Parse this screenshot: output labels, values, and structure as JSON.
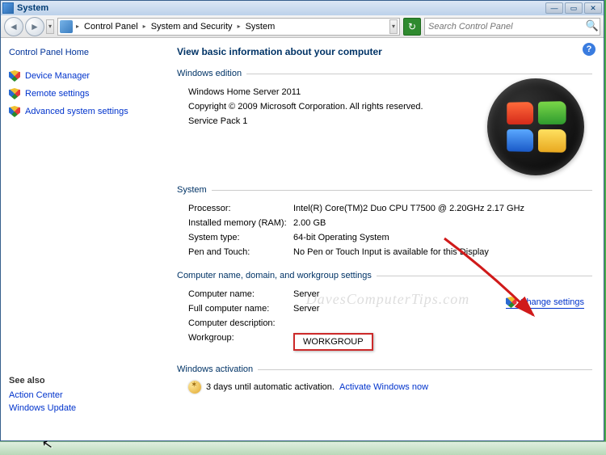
{
  "window": {
    "title": "System"
  },
  "breadcrumb": {
    "root": "Control Panel",
    "mid": "System and Security",
    "leaf": "System"
  },
  "search": {
    "placeholder": "Search Control Panel"
  },
  "sidebar": {
    "home": "Control Panel Home",
    "links": [
      {
        "label": "Device Manager"
      },
      {
        "label": "Remote settings"
      },
      {
        "label": "Advanced system settings"
      }
    ],
    "see_also_title": "See also",
    "see_also": [
      {
        "label": "Action Center"
      },
      {
        "label": "Windows Update"
      }
    ]
  },
  "main": {
    "heading": "View basic information about your computer",
    "edition": {
      "legend": "Windows edition",
      "name": "Windows Home Server 2011",
      "copyright": "Copyright © 2009 Microsoft Corporation.  All rights reserved.",
      "sp": "Service Pack 1"
    },
    "system": {
      "legend": "System",
      "processor_label": "Processor:",
      "processor": "Intel(R) Core(TM)2 Duo CPU    T7500  @ 2.20GHz   2.17 GHz",
      "ram_label": "Installed memory (RAM):",
      "ram": "2.00 GB",
      "type_label": "System type:",
      "type": "64-bit Operating System",
      "pen_label": "Pen and Touch:",
      "pen": "No Pen or Touch Input is available for this Display"
    },
    "computer": {
      "legend": "Computer name, domain, and workgroup settings",
      "name_label": "Computer name:",
      "name": "Server",
      "full_label": "Full computer name:",
      "full": "Server",
      "desc_label": "Computer description:",
      "desc": "",
      "workgroup_label": "Workgroup:",
      "workgroup": "WORKGROUP",
      "change": "Change settings"
    },
    "activation": {
      "legend": "Windows activation",
      "text1": "3 days until automatic activation. ",
      "link": "Activate Windows now"
    }
  },
  "watermark": "DavesComputerTips.com"
}
